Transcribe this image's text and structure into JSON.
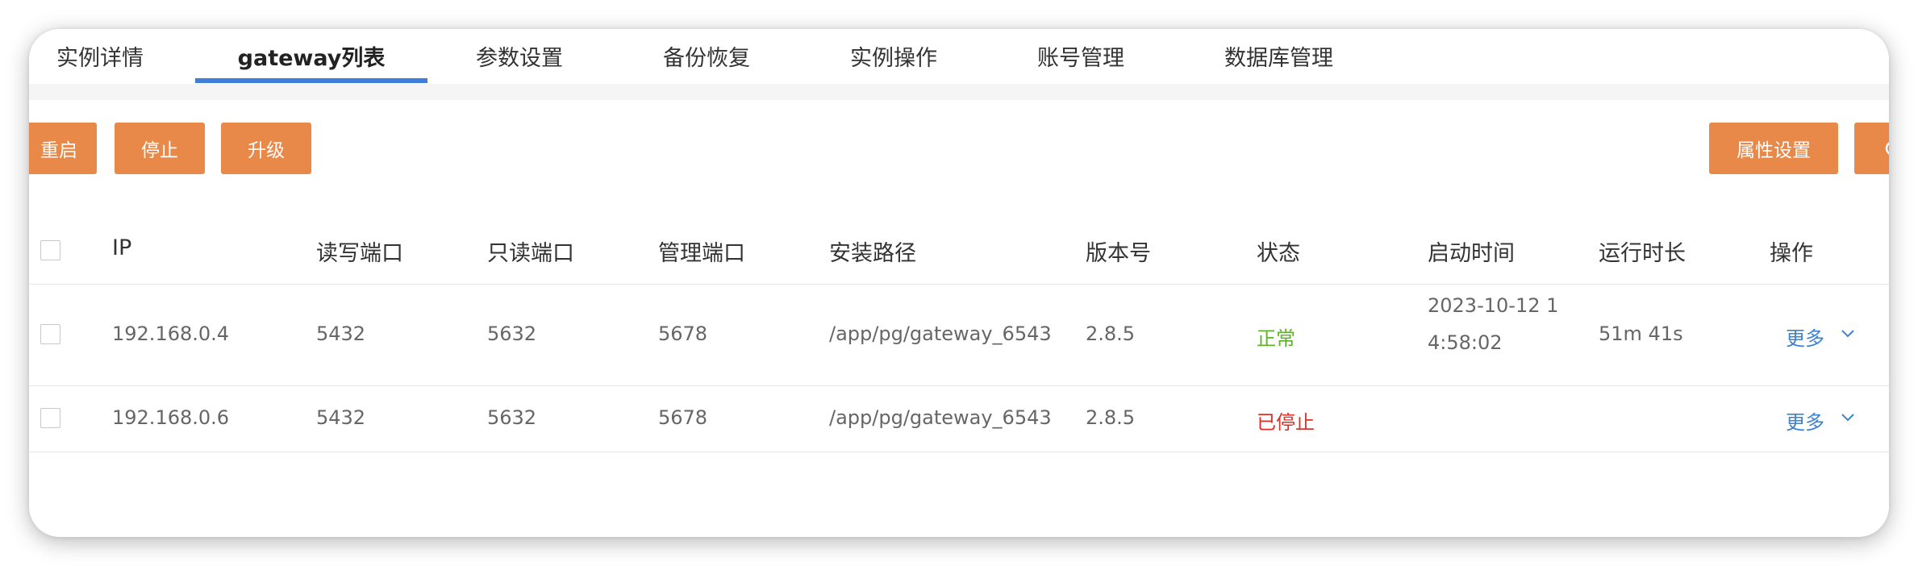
{
  "tabs": [
    {
      "label": "实例详情"
    },
    {
      "label": "gateway列表"
    },
    {
      "label": "参数设置"
    },
    {
      "label": "备份恢复"
    },
    {
      "label": "实例操作"
    },
    {
      "label": "账号管理"
    },
    {
      "label": "数据库管理"
    }
  ],
  "toolbar": {
    "restart_label": "重启",
    "stop_label": "停止",
    "upgrade_label": "升级",
    "properties_label": "属性设置"
  },
  "table": {
    "columns": [
      "IP",
      "读写端口",
      "只读端口",
      "管理端口",
      "安装路径",
      "版本号",
      "状态",
      "启动时间",
      "运行时长",
      "操作"
    ],
    "rows": [
      {
        "ip": "192.168.0.4",
        "rw_port": "5432",
        "ro_port": "5632",
        "admin_port": "5678",
        "path": "/app/pg/gateway_6543",
        "version": "2.8.5",
        "status": "正常",
        "start_time_line1": "2023-10-12 1",
        "start_time_line2": "4:58:02",
        "uptime": "51m 41s",
        "action": "更多"
      },
      {
        "ip": "192.168.0.6",
        "rw_port": "5432",
        "ro_port": "5632",
        "admin_port": "5678",
        "path": "/app/pg/gateway_6543",
        "version": "2.8.5",
        "status": "已停止",
        "start_time_line1": "",
        "start_time_line2": "",
        "uptime": "",
        "action": "更多"
      }
    ]
  },
  "colors": {
    "accent": "#3f7fd8",
    "button": "#e8894a",
    "status_ok": "#5fb02b",
    "status_stopped": "#d8322a",
    "link": "#3b82d0"
  },
  "icons": {
    "dropdown": "chevron-down-icon"
  }
}
